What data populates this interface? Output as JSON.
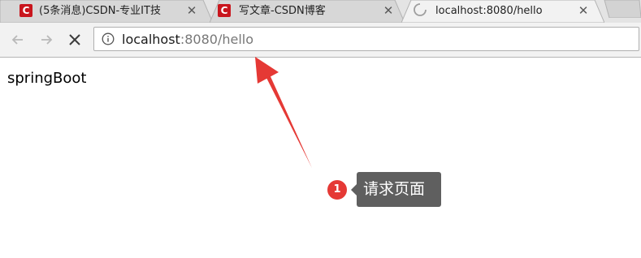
{
  "browser": {
    "tabs": [
      {
        "title": "(5条消息)CSDN-专业IT技",
        "favicon": "csdn-logo",
        "favicon_letter": "C",
        "active": false
      },
      {
        "title": "写文章-CSDN博客",
        "favicon": "csdn-logo",
        "favicon_letter": "C",
        "active": false
      },
      {
        "title": "localhost:8080/hello",
        "favicon": "loading-spinner",
        "active": true
      }
    ],
    "toolbar": {
      "back_icon": "back-arrow-icon",
      "forward_icon": "forward-arrow-icon",
      "stop_icon": "stop-x-icon",
      "address_icon": "info-circle-icon",
      "url_host": "localhost",
      "url_rest": ":8080/hello"
    }
  },
  "page": {
    "body_text": "springBoot"
  },
  "annotation": {
    "number": "1",
    "label": "请求页面",
    "arrow_color": "#e53935",
    "badge_color": "#e53935",
    "label_background": "#5f5f5f"
  },
  "colors": {
    "csdn_red": "#c9161d",
    "tabstrip_bg": "#e4e4e4",
    "active_tab_bg": "#f2f2f2",
    "inactive_tab_bg": "#d7d7d7"
  }
}
